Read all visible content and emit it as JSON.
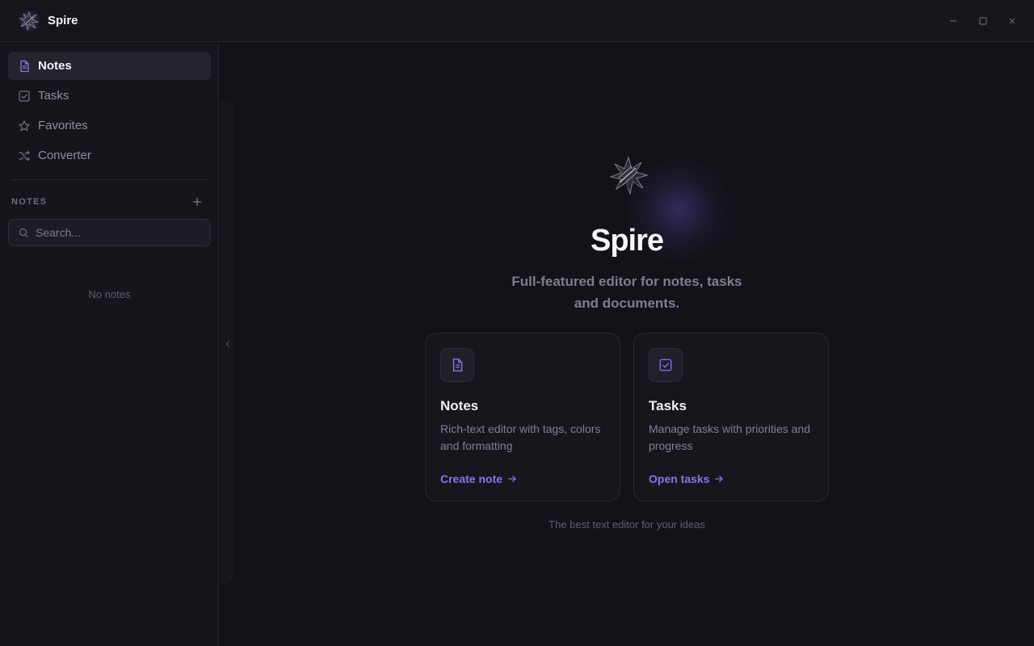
{
  "window": {
    "app_name": "Spire"
  },
  "sidebar": {
    "nav": [
      {
        "label": "Notes",
        "icon": "document-icon",
        "active": true
      },
      {
        "label": "Tasks",
        "icon": "checkbox-icon",
        "active": false
      },
      {
        "label": "Favorites",
        "icon": "star-icon",
        "active": false
      },
      {
        "label": "Converter",
        "icon": "shuffle-icon",
        "active": false
      }
    ],
    "section_label": "NOTES",
    "search_placeholder": "Search...",
    "empty_text": "No notes"
  },
  "hero": {
    "title": "Spire",
    "subtitle": "Full-featured editor for notes, tasks and documents."
  },
  "cards": [
    {
      "title": "Notes",
      "description": "Rich-text editor with tags, colors and formatting",
      "link": "Create note",
      "icon": "document-icon"
    },
    {
      "title": "Tasks",
      "description": "Manage tasks with priorities and progress",
      "link": "Open tasks",
      "icon": "checkbox-icon"
    }
  ],
  "footer": "The best text editor for your ideas",
  "colors": {
    "accent": "#8a74ee",
    "background": "#121319",
    "sidebar": "#15161c"
  }
}
